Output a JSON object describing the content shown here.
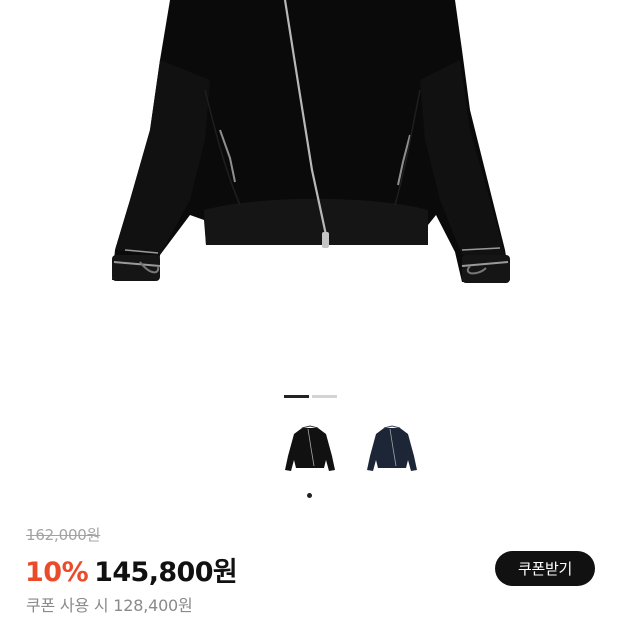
{
  "product": {
    "original_price": "162,000원",
    "discount_rate": "10%",
    "sale_price": "145,800원",
    "coupon_price": "쿠폰 사용 시 128,400원"
  },
  "actions": {
    "coupon_button_label": "쿠폰받기"
  },
  "gallery": {
    "current_index": 1,
    "total_images": 2,
    "thumbnails": [
      {
        "color": "#111111",
        "selected": true
      },
      {
        "color": "#1c2636",
        "selected": false
      }
    ]
  },
  "colors": {
    "discount": "#ec4b2a",
    "price": "#111111",
    "button_bg": "#111111"
  }
}
